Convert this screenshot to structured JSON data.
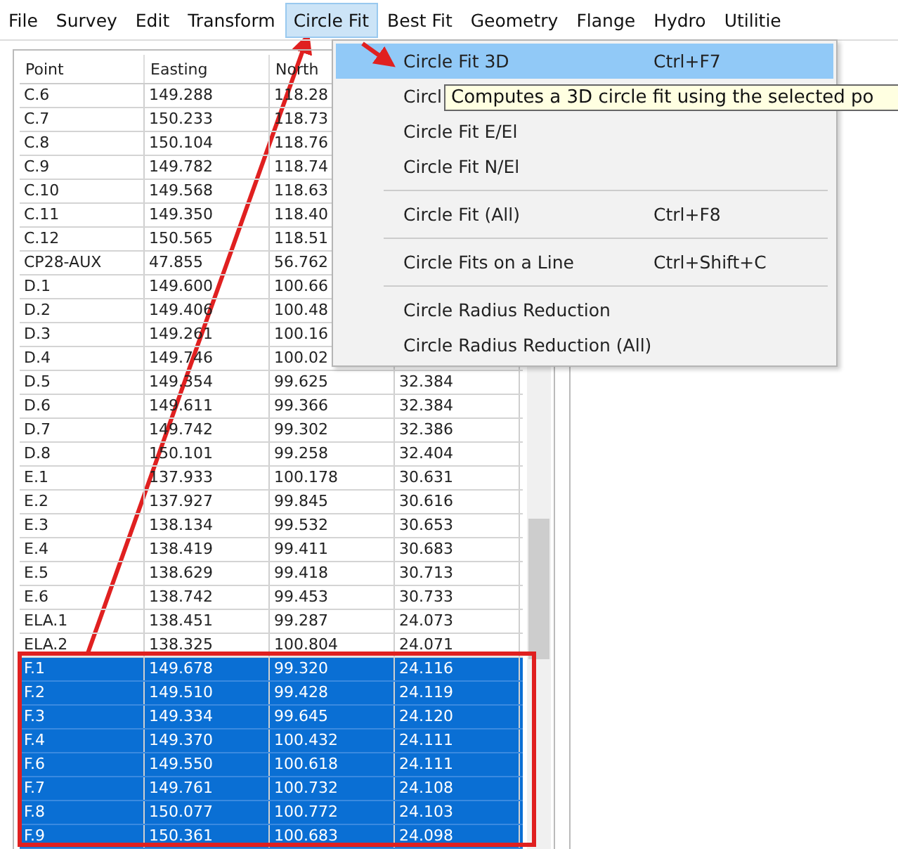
{
  "menu_bar": [
    {
      "label": "File",
      "selected": false
    },
    {
      "label": "Survey",
      "selected": false
    },
    {
      "label": "Edit",
      "selected": false
    },
    {
      "label": "Transform",
      "selected": false
    },
    {
      "label": "Circle Fit",
      "selected": true
    },
    {
      "label": "Best Fit",
      "selected": false
    },
    {
      "label": "Geometry",
      "selected": false
    },
    {
      "label": "Flange",
      "selected": false
    },
    {
      "label": "Hydro",
      "selected": false
    },
    {
      "label": "Utilitie",
      "selected": false
    }
  ],
  "table": {
    "columns": [
      "Point",
      "Easting",
      "North"
    ],
    "rows": [
      {
        "cells": [
          "C.6",
          "149.288",
          "118.28"
        ],
        "selected": false
      },
      {
        "cells": [
          "C.7",
          "150.233",
          "118.73"
        ],
        "selected": false
      },
      {
        "cells": [
          "C.8",
          "150.104",
          "118.76"
        ],
        "selected": false
      },
      {
        "cells": [
          "C.9",
          "149.782",
          "118.74"
        ],
        "selected": false
      },
      {
        "cells": [
          "C.10",
          "149.568",
          "118.63"
        ],
        "selected": false
      },
      {
        "cells": [
          "C.11",
          "149.350",
          "118.40"
        ],
        "selected": false
      },
      {
        "cells": [
          "C.12",
          "150.565",
          "118.51"
        ],
        "selected": false
      },
      {
        "cells": [
          "CP28-AUX",
          "47.855",
          "56.762"
        ],
        "selected": false
      },
      {
        "cells": [
          "D.1",
          "149.600",
          "100.66"
        ],
        "selected": false
      },
      {
        "cells": [
          "D.2",
          "149.406",
          "100.48"
        ],
        "selected": false
      },
      {
        "cells": [
          "D.3",
          "149.261",
          "100.16"
        ],
        "selected": false
      },
      {
        "cells": [
          "D.4",
          "149.746",
          "100.02"
        ],
        "selected": false
      },
      {
        "cells": [
          "D.5",
          "149.354",
          "99.625",
          "32.384"
        ],
        "selected": false
      },
      {
        "cells": [
          "D.6",
          "149.611",
          "99.366",
          "32.384"
        ],
        "selected": false
      },
      {
        "cells": [
          "D.7",
          "149.742",
          "99.302",
          "32.386"
        ],
        "selected": false
      },
      {
        "cells": [
          "D.8",
          "150.101",
          "99.258",
          "32.404"
        ],
        "selected": false
      },
      {
        "cells": [
          "E.1",
          "137.933",
          "100.178",
          "30.631"
        ],
        "selected": false
      },
      {
        "cells": [
          "E.2",
          "137.927",
          "99.845",
          "30.616"
        ],
        "selected": false
      },
      {
        "cells": [
          "E.3",
          "138.134",
          "99.532",
          "30.653"
        ],
        "selected": false
      },
      {
        "cells": [
          "E.4",
          "138.419",
          "99.411",
          "30.683"
        ],
        "selected": false
      },
      {
        "cells": [
          "E.5",
          "138.629",
          "99.418",
          "30.713"
        ],
        "selected": false
      },
      {
        "cells": [
          "E.6",
          "138.742",
          "99.453",
          "30.733"
        ],
        "selected": false
      },
      {
        "cells": [
          "ELA.1",
          "138.451",
          "99.287",
          "24.073"
        ],
        "selected": false
      },
      {
        "cells": [
          "ELA.2",
          "138.325",
          "100.804",
          "24.071"
        ],
        "selected": false
      },
      {
        "cells": [
          "F.1",
          "149.678",
          "99.320",
          "24.116"
        ],
        "selected": true
      },
      {
        "cells": [
          "F.2",
          "149.510",
          "99.428",
          "24.119"
        ],
        "selected": true
      },
      {
        "cells": [
          "F.3",
          "149.334",
          "99.645",
          "24.120"
        ],
        "selected": true
      },
      {
        "cells": [
          "F.4",
          "149.370",
          "100.432",
          "24.111"
        ],
        "selected": true
      },
      {
        "cells": [
          "F.6",
          "149.550",
          "100.618",
          "24.111"
        ],
        "selected": true
      },
      {
        "cells": [
          "F.7",
          "149.761",
          "100.732",
          "24.108"
        ],
        "selected": true
      },
      {
        "cells": [
          "F.8",
          "150.077",
          "100.772",
          "24.103"
        ],
        "selected": true
      },
      {
        "cells": [
          "F.9",
          "150.361",
          "100.683",
          "24.098"
        ],
        "selected": true
      }
    ]
  },
  "dropdown_menu": [
    {
      "kind": "item",
      "label": "Circle Fit 3D",
      "shortcut": "Ctrl+F7",
      "selected": true
    },
    {
      "kind": "item",
      "label": "Circl",
      "selected": false
    },
    {
      "kind": "item",
      "label": "Circle Fit E/El",
      "selected": false
    },
    {
      "kind": "item",
      "label": "Circle Fit N/El",
      "selected": false
    },
    {
      "kind": "separator"
    },
    {
      "kind": "item",
      "label": "Circle Fit (All)",
      "shortcut": "Ctrl+F8",
      "selected": false
    },
    {
      "kind": "separator"
    },
    {
      "kind": "item",
      "label": "Circle Fits on a Line",
      "shortcut": "Ctrl+Shift+C",
      "selected": false
    },
    {
      "kind": "separator"
    },
    {
      "kind": "item",
      "label": "Circle Radius Reduction",
      "selected": false
    },
    {
      "kind": "item",
      "label": "Circle Radius Reduction (All)",
      "selected": false
    }
  ],
  "tooltip": "Computes a 3D circle fit using the selected po"
}
